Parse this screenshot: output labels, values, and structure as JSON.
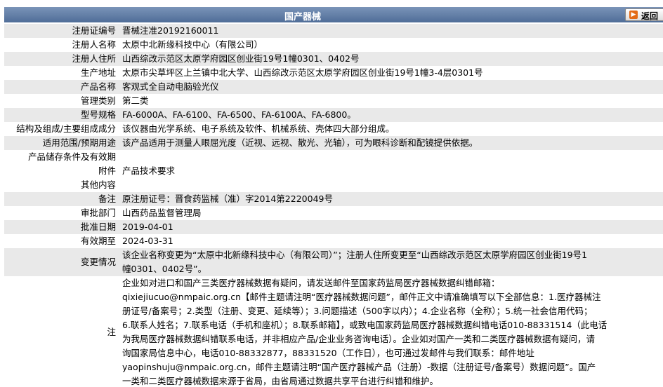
{
  "header": {
    "title": "国产器械",
    "back_label": "返回"
  },
  "fields": {
    "reg_no": {
      "label": "注册证编号",
      "value": "晋械注准20192160011"
    },
    "reg_name": {
      "label": "注册人名称",
      "value": "太原中北新缘科技中心（有限公司）"
    },
    "reg_addr": {
      "label": "注册人住所",
      "value": "山西综改示范区太原学府园区创业街19号1幢0301、0402号"
    },
    "prod_addr": {
      "label": "生产地址",
      "value": "太原市尖草坪区上兰镇中北大学、山西综改示范区太原学府园区创业街19号1幢3-4层0301号"
    },
    "prod_name": {
      "label": "产品名称",
      "value": "客观式全自动电脑验光仪"
    },
    "mgmt_cat": {
      "label": "管理类别",
      "value": "第二类"
    },
    "model": {
      "label": "型号规格",
      "value": "FA-6000A、FA-6100、FA-6500、FA-6100A、FA-6800。"
    },
    "structure": {
      "label": "结构及组成/主要组成成分",
      "value": "该仪器由光学系统、电子系统及软件、机械系统、壳体四大部分组成。"
    },
    "scope": {
      "label": "适用范围/预期用途",
      "value": "该产品适用于测量人眼屈光度（近视、远视、散光、光轴），可为眼科诊断和配镜提供依据。"
    },
    "storage": {
      "label": "产品储存条件及有效期",
      "value": ""
    },
    "attach": {
      "label": "附件",
      "value": "产品技术要求"
    },
    "other": {
      "label": "其他内容",
      "value": ""
    },
    "remark": {
      "label": "备注",
      "value": "原注册证号：晋食药监械（准）字2014第2220049号"
    },
    "approver": {
      "label": "审批部门",
      "value": "山西药品监督管理局"
    },
    "approve_date": {
      "label": "批准日期",
      "value": "2019-04-01"
    },
    "valid_until": {
      "label": "有效期至",
      "value": "2024-03-31"
    },
    "changes": {
      "label": "变更情况",
      "line1": "该企业名称变更为“太原中北新缘科技中心（有限公司）”；注册人住所变更至“山西综改示范区太原学府园区创业街19号1",
      "line2": "幢0301、0402号”。"
    },
    "note": {
      "label": "注",
      "lines": [
        "企业如对进口和国产三类医疗器械数据有疑问，请发送邮件至国家药监局医疗器械数据纠错邮箱：",
        "qixiejiucuo@nmpaic.org.cn【邮件主题请注明“医疗器械数据问题”，邮件正文中请准确填写以下全部信息：1.医疗器械注",
        "册证号/备案号；2.类型（注册、变更、延续等）；3.问题描述（500字以内）；4.企业名称（全称）；5.统一社会信用代码；",
        "6.联系人姓名；7.联系电话（手机和座机）；8.联系邮箱】，或致电国家药监局医疗器械数据纠错电话010-88331514（此电话",
        "为我局医疗器械数据纠错联系电话，并非相应产品/企业业务咨询电话）。企业如对国产一类和二类医疗器械数据有疑问，请",
        "询国家局信息中心，电话010-88332877，88331520（工作日），也可通过发邮件与我们联系：邮件地址",
        "yaopinshuju@nmpaic.org.cn，邮件主题请注明“国产医疗器械产品（注册）-数据（注册证号/备案号）数据问题”。国产",
        "一类和二类医疗器械数据来源于省局，由省局通过数据共享平台进行纠错和维护。"
      ]
    }
  }
}
